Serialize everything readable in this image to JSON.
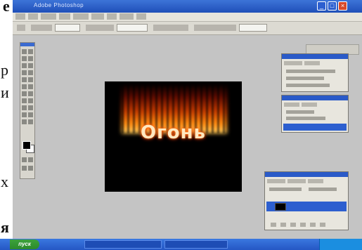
{
  "surrounding_text": {
    "top_right": "е",
    "left_p": "р",
    "left_i": "и",
    "left_kh": "х",
    "bottom_ya": "я"
  },
  "app": {
    "title": "Adobe Photoshop",
    "window_controls": {
      "minimize": "_",
      "maximize": "□",
      "close": "×"
    }
  },
  "canvas": {
    "text": "Огонь",
    "background_color": "#000000",
    "effect": "fire"
  },
  "panels": {
    "layers": {
      "active_layer_label": ""
    }
  },
  "taskbar": {
    "start_label": "пуск"
  },
  "colors": {
    "title_bar": "#2a5ac8",
    "workspace": "#c4c4c4",
    "taskbar": "#2557c4",
    "selection": "#2d5fcf"
  }
}
